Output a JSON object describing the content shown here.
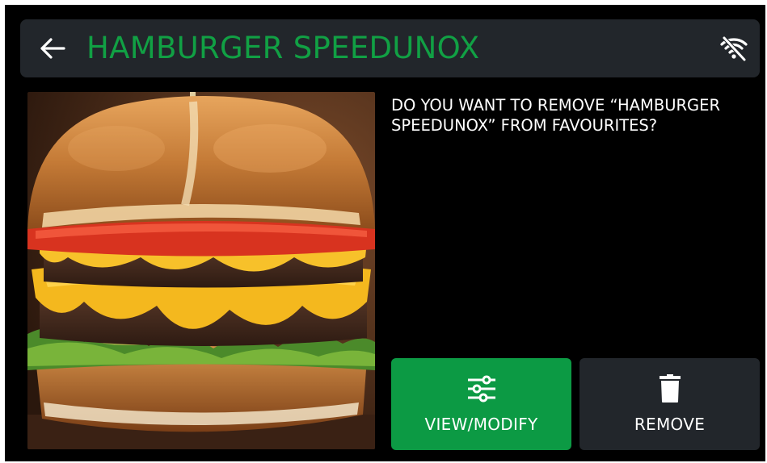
{
  "header": {
    "title": "HAMBURGER SPEEDUNOX",
    "back_icon": "arrow-left-icon",
    "status_icon": "wifi-off-icon"
  },
  "photo": {
    "alt": "Hamburger photo"
  },
  "dialog": {
    "prompt": "DO YOU WANT TO REMOVE “HAMBURGER SPEEDUNOX” FROM FAVOURITES?"
  },
  "actions": {
    "view_modify_label": "VIEW/MODIFY",
    "view_modify_icon": "sliders-icon",
    "remove_label": "REMOVE",
    "remove_icon": "trash-icon"
  },
  "colors": {
    "accent_green": "#11a044",
    "button_green": "#0c9a44",
    "panel_dark": "#22262b",
    "background": "#000000"
  }
}
